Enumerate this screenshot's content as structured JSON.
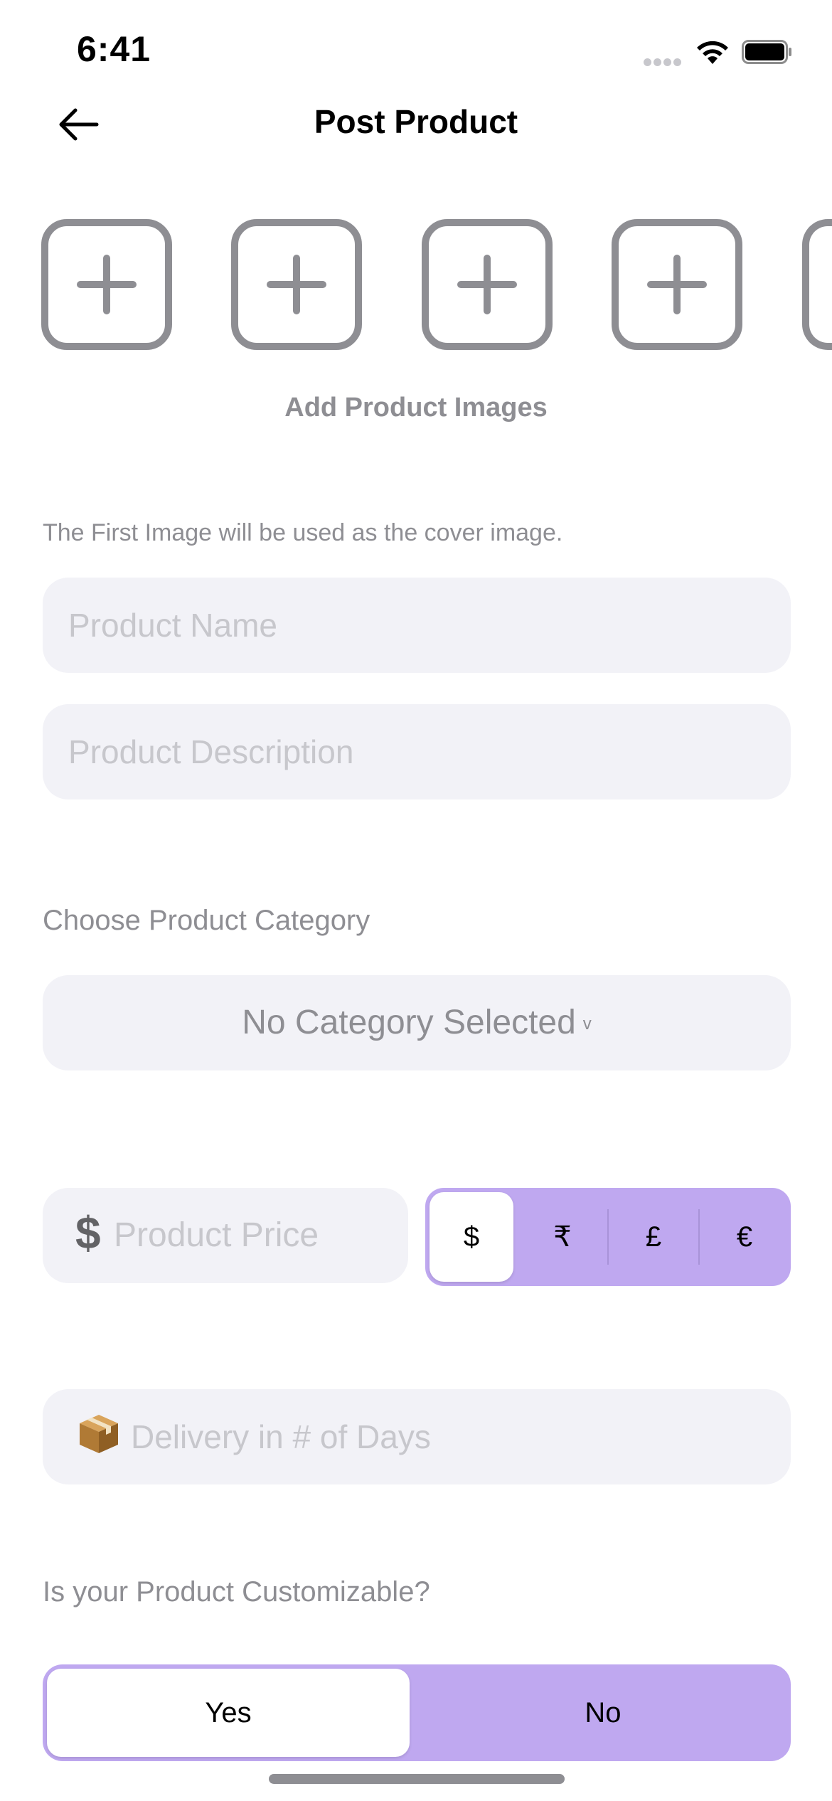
{
  "status_bar": {
    "time": "6:41"
  },
  "header": {
    "title": "Post Product"
  },
  "images": {
    "add_label": "Add Product Images",
    "slots": [
      "slot-1",
      "slot-2",
      "slot-3",
      "slot-4",
      "slot-5"
    ],
    "hint": "The First Image will be used as the cover image."
  },
  "form": {
    "name_placeholder": "Product Name",
    "description_placeholder": "Product Description",
    "category_label": "Choose Product Category",
    "category_value": "No Category Selected",
    "category_chevron": "v",
    "price_symbol": "$",
    "price_placeholder": "Product Price",
    "currencies": [
      "$",
      "₹",
      "£",
      "€"
    ],
    "selected_currency": "$",
    "delivery_placeholder": "Delivery in # of Days",
    "customizable_label": "Is your Product Customizable?",
    "customizable_options": [
      "Yes",
      "No"
    ],
    "customizable_selected": "Yes"
  },
  "colors": {
    "accent": "#bfa8f0",
    "field_bg": "#f2f2f7",
    "icon_gray": "#8e8e93"
  }
}
